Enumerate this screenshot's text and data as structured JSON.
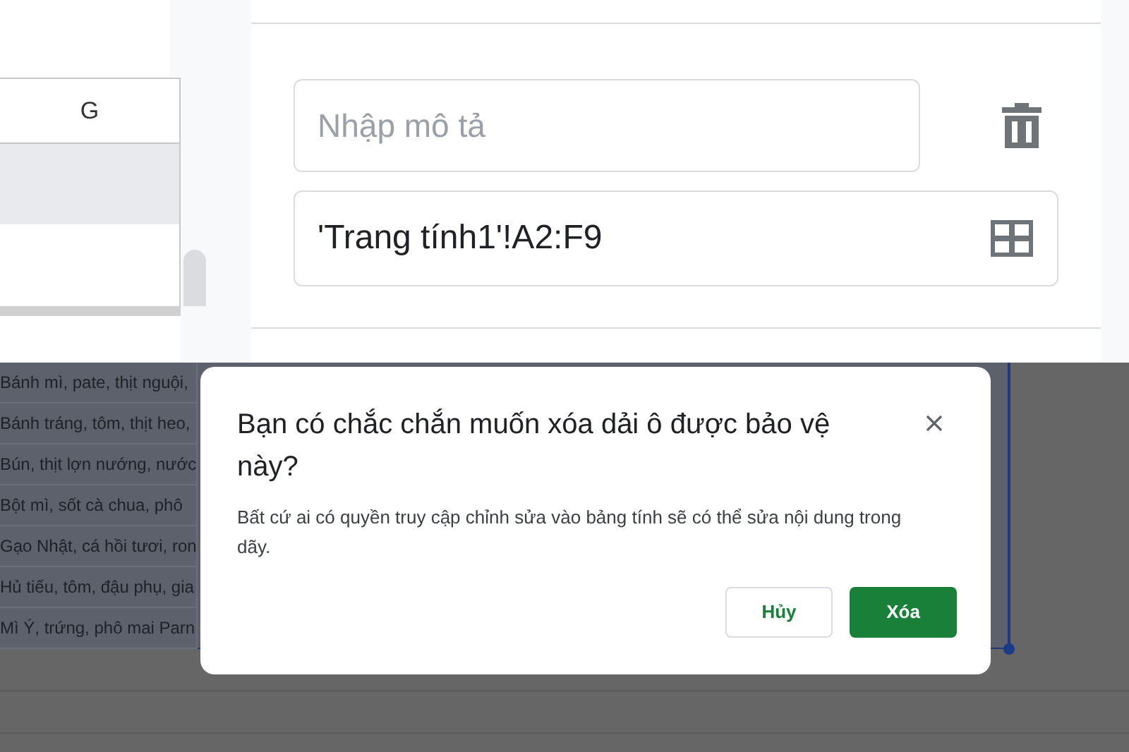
{
  "sheet": {
    "column_header": "G",
    "rows": [
      "Bánh mì, pate, thịt nguội,",
      "Bánh tráng, tôm, thịt heo,",
      "Bún, thịt lợn nướng, nước",
      "Bột mì, sốt cà chua, phô",
      "Gạo Nhật, cá hồi tươi, ron",
      "Hủ tiếu, tôm, đậu phụ, gia",
      "Mì Ý, trứng, phô mai Parn"
    ]
  },
  "panel": {
    "description_field": {
      "placeholder": "Nhập mô tả"
    },
    "range_field": {
      "value": "'Trang tính1'!A2:F9"
    }
  },
  "dialog": {
    "title": "Bạn có chắc chắn muốn xóa dải ô được bảo vệ này?",
    "message": "Bất cứ ai có quyền truy cập chỉnh sửa vào bảng tính sẽ có thể sửa nội dung trong dãy.",
    "buttons": [
      {
        "label": "Hủy",
        "kind": "secondary"
      },
      {
        "label": "Xóa",
        "kind": "primary"
      }
    ]
  }
}
